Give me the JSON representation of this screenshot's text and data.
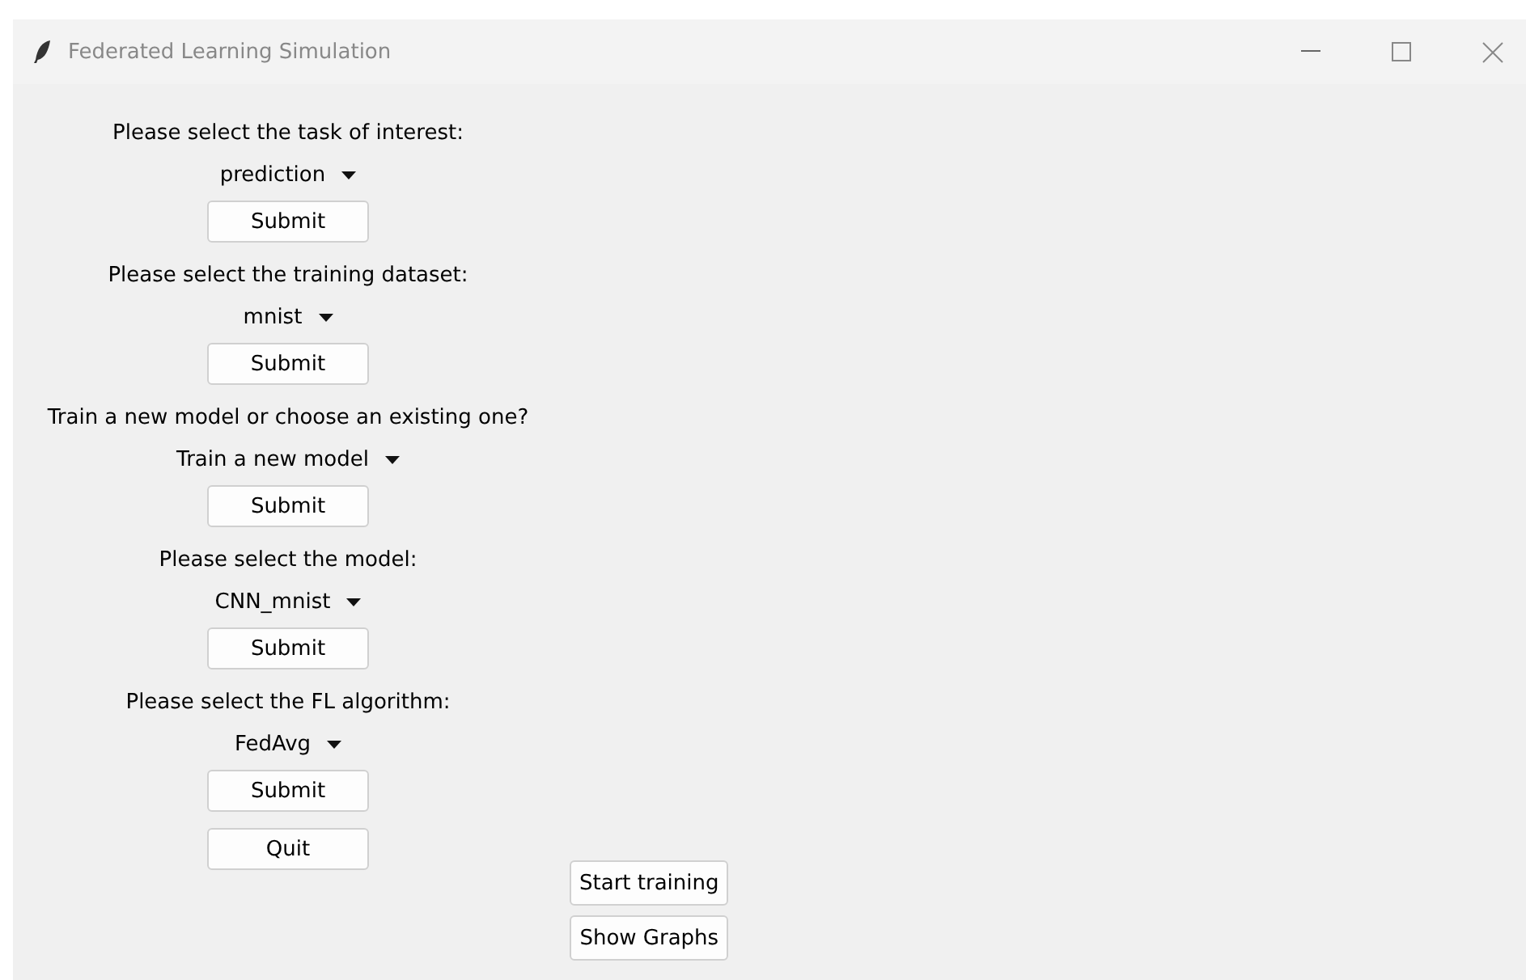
{
  "window": {
    "title": "Federated Learning Simulation"
  },
  "sections": [
    {
      "prompt": "Please select the task of interest:",
      "dropdown": "prediction",
      "button": "Submit"
    },
    {
      "prompt": "Please select the training dataset:",
      "dropdown": "mnist",
      "button": "Submit"
    },
    {
      "prompt": "Train a new model or choose an existing one?",
      "dropdown": "Train a new model",
      "button": "Submit"
    },
    {
      "prompt": "Please select the model:",
      "dropdown": "CNN_mnist",
      "button": "Submit"
    },
    {
      "prompt": "Please select the FL algorithm:",
      "dropdown": "FedAvg",
      "button": "Submit"
    }
  ],
  "quit_button": "Quit",
  "side_buttons": [
    "Start training",
    "Show Graphs"
  ]
}
